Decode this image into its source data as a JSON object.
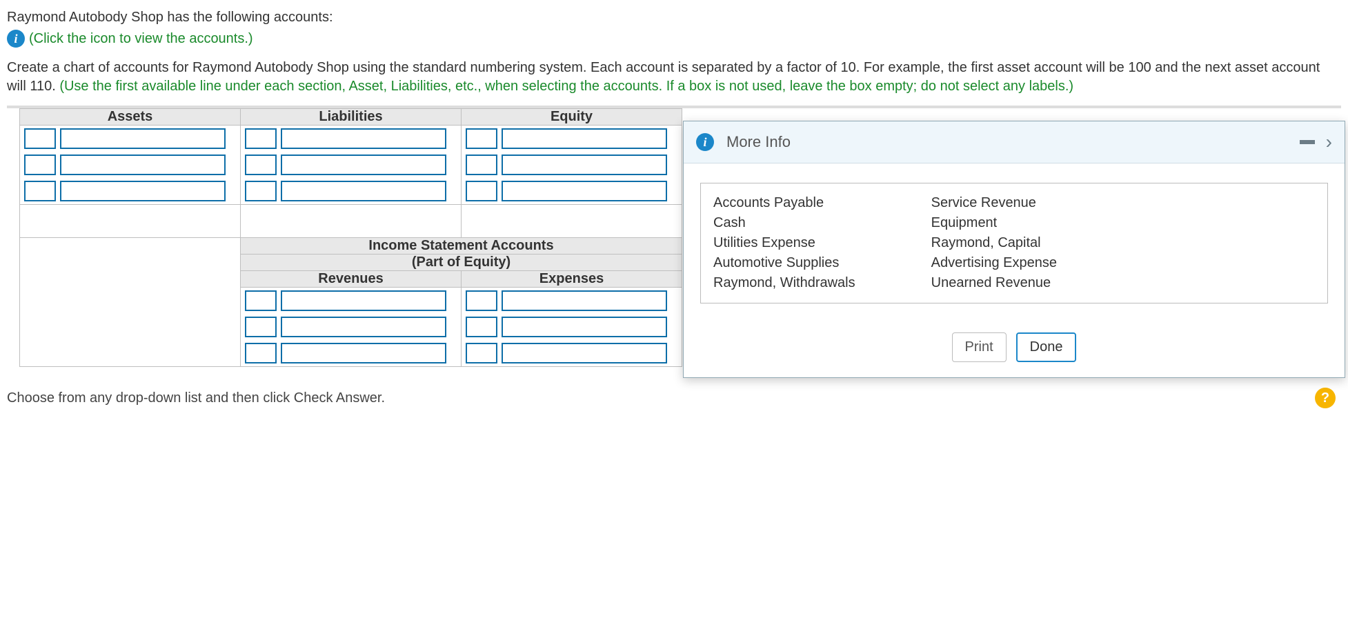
{
  "intro": {
    "line1": "Raymond Autobody Shop has the following accounts:",
    "click_hint": "(Click the icon to view the accounts.)",
    "instructions_black": "Create a chart of accounts for Raymond Autobody Shop using the standard numbering system. Each account is separated by a factor of 10. For example, the first asset account will be 100 and the next asset account will 110. ",
    "instructions_green": "(Use the first available line under each section, Asset, Liabilities, etc., when selecting the accounts. If a box is not used, leave the box empty; do not select any labels.)"
  },
  "headers": {
    "assets": "Assets",
    "liabilities": "Liabilities",
    "equity": "Equity",
    "income_title": "Income Statement Accounts",
    "income_sub": "(Part of Equity)",
    "revenues": "Revenues",
    "expenses": "Expenses"
  },
  "more_info": {
    "title": "More Info",
    "accounts_col1": [
      "Accounts Payable",
      "Cash",
      "Utilities Expense",
      "Automotive Supplies",
      "Raymond, Withdrawals"
    ],
    "accounts_col2": [
      "Service Revenue",
      "Equipment",
      "Raymond, Capital",
      "Advertising Expense",
      "Unearned Revenue"
    ],
    "print": "Print",
    "done": "Done"
  },
  "footer": {
    "hint": "Choose from any drop-down list and then click Check Answer."
  }
}
